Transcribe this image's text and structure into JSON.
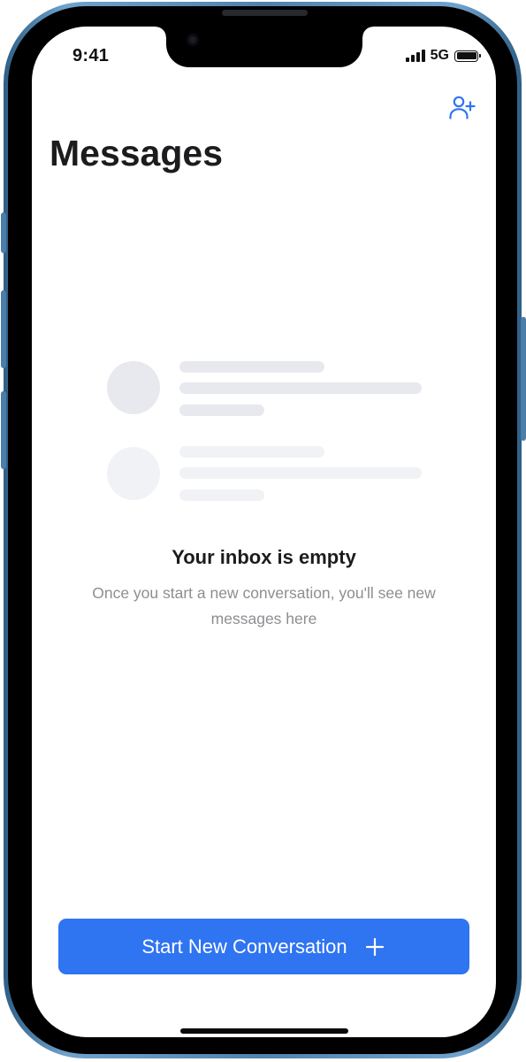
{
  "status_bar": {
    "time": "9:41",
    "network": "5G",
    "signal_icon": "cellular-signal-icon",
    "battery_icon": "battery-icon"
  },
  "header": {
    "title": "Messages",
    "add_contact_icon": "person-plus-icon"
  },
  "empty_state": {
    "title": "Your inbox is empty",
    "description": "Once you start a new conversation, you'll see new messages here"
  },
  "primary_action": {
    "label": "Start New Conversation",
    "icon": "plus-icon"
  },
  "colors": {
    "accent": "#2f74f1",
    "title_text": "#1c1c1e",
    "secondary_text": "#8e8e93",
    "skeleton_primary": "#e8e9ee",
    "skeleton_secondary": "#f1f2f5",
    "device_frame": "#4f82ad"
  }
}
